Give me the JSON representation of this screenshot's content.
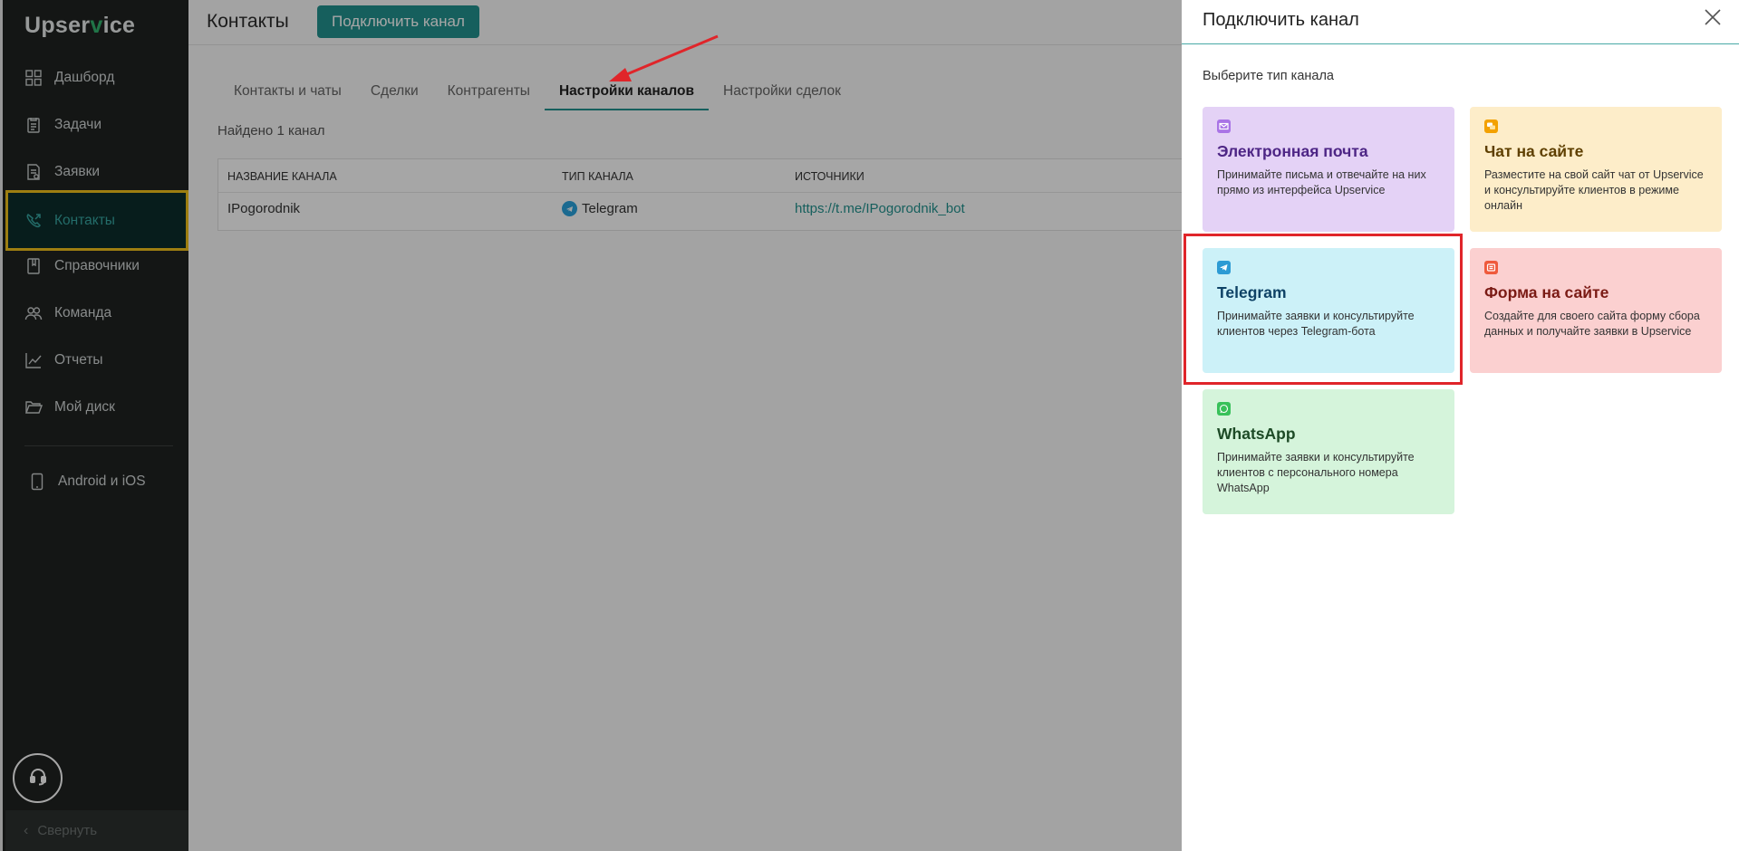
{
  "app": {
    "logo_prefix": "Upser",
    "logo_v": "v",
    "logo_suffix": "ice"
  },
  "sidebar": {
    "items": [
      {
        "label": "Дашборд",
        "icon": "dashboard-icon"
      },
      {
        "label": "Задачи",
        "icon": "tasks-icon"
      },
      {
        "label": "Заявки",
        "icon": "requests-icon"
      },
      {
        "label": "Контакты",
        "icon": "contacts-icon",
        "active": true
      },
      {
        "label": "Справочники",
        "icon": "book-icon"
      },
      {
        "label": "Команда",
        "icon": "team-icon"
      },
      {
        "label": "Отчеты",
        "icon": "chart-icon"
      },
      {
        "label": "Мой диск",
        "icon": "folder-icon"
      },
      {
        "label": "Android и iOS",
        "icon": "phone-icon"
      }
    ],
    "collapse_label": "Свернуть"
  },
  "main": {
    "title": "Контакты",
    "connect_button": "Подключить канал",
    "tabs": [
      "Контакты и чаты",
      "Сделки",
      "Контрагенты",
      "Настройки каналов",
      "Настройки сделок"
    ],
    "found_text": "Найдено 1 канал",
    "table": {
      "headers": [
        "Название канала",
        "Тип канала",
        "Источники"
      ],
      "rows": [
        {
          "name": "IPogorodnik",
          "type": "Telegram",
          "source": "https://t.me/IPogorodnik_bot"
        }
      ]
    }
  },
  "drawer": {
    "title": "Подключить канал",
    "subtitle": "Выберите тип канала",
    "cards": {
      "email": {
        "title": "Электронная почта",
        "desc": "Принимайте письма и отвечайте на них прямо из интерфейса Upservice"
      },
      "chat": {
        "title": "Чат на сайте",
        "desc": "Разместите на свой сайт чат от Upservice и консультируйте клиентов в режиме онлайн"
      },
      "telegram": {
        "title": "Telegram",
        "desc": "Принимайте заявки и консультируйте клиентов через Telegram-бота"
      },
      "form": {
        "title": "Форма на сайте",
        "desc": "Создайте для своего сайта форму сбора данных и получайте заявки в Upservice"
      },
      "whatsapp": {
        "title": "WhatsApp",
        "desc": "Принимайте заявки и консультируйте клиентов с персонального номера WhatsApp"
      }
    }
  },
  "colors": {
    "accent": "#22938f",
    "highlight_yellow": "#f1c21b",
    "annotation_red": "#e0252a"
  }
}
